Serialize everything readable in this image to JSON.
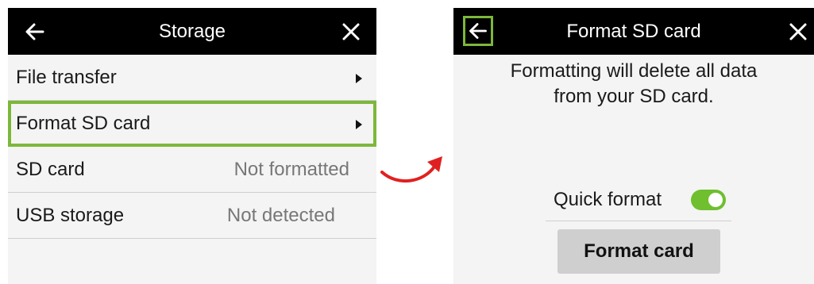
{
  "left_screen": {
    "title": "Storage",
    "back_icon": "back-arrow-icon",
    "close_icon": "close-icon",
    "items": [
      {
        "label": "File transfer",
        "value": "",
        "has_chevron": true
      },
      {
        "label": "Format SD card",
        "value": "",
        "has_chevron": true,
        "highlighted": true
      },
      {
        "label": "SD card",
        "value": "Not formatted",
        "has_chevron": false
      },
      {
        "label": "USB storage",
        "value": "Not detected",
        "has_chevron": false
      }
    ]
  },
  "right_screen": {
    "title": "Format SD card",
    "back_icon": "back-arrow-icon",
    "close_icon": "close-icon",
    "message_lines": [
      "Formatting will delete all data",
      "from your SD card."
    ],
    "quick_format_label": "Quick format",
    "quick_format_on": true,
    "format_button_label": "Format card"
  },
  "colors": {
    "highlight": "#7cb83a",
    "toggle_on": "#6fbf2f",
    "arrow": "#e02020",
    "titlebar": "#000000"
  }
}
